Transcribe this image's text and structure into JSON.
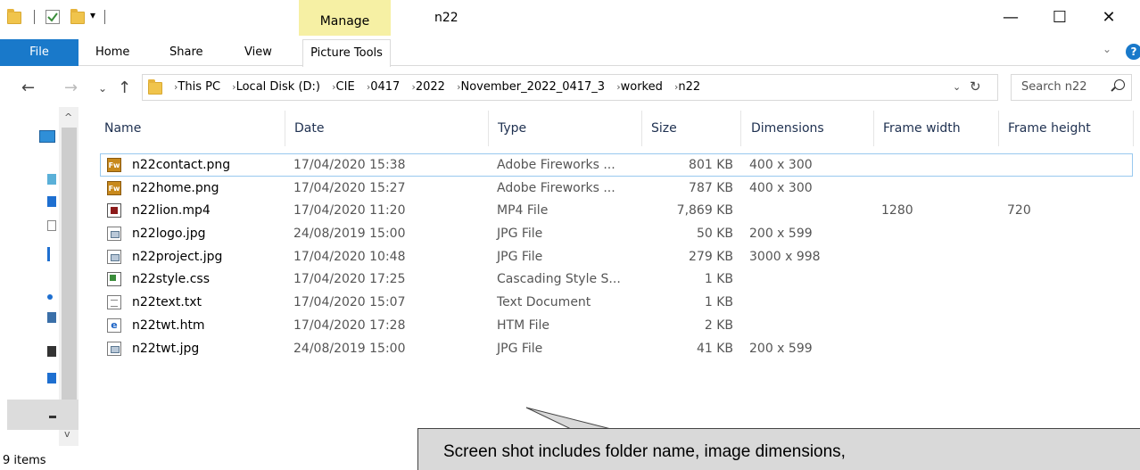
{
  "window": {
    "title": "n22",
    "contextual_tab": "Manage",
    "controls": {
      "minimize": "—",
      "maximize": "☐",
      "close": "✕"
    }
  },
  "ribbon": {
    "tabs": [
      "File",
      "Home",
      "Share",
      "View",
      "Picture Tools"
    ],
    "collapse_glyph": "⌄",
    "help_glyph": "?"
  },
  "address": {
    "back": "←",
    "forward": "→",
    "recent": "⌄",
    "up": "↑",
    "breadcrumbs": [
      "This PC",
      "Local Disk (D:)",
      "CIE",
      "0417",
      "2022",
      "November_2022_0417_3",
      "worked",
      "n22"
    ],
    "separator": "›",
    "dropdown": "⌄",
    "refresh": "↻"
  },
  "search": {
    "placeholder": "Search n22"
  },
  "columns": {
    "name": "Name",
    "date": "Date",
    "type": "Type",
    "size": "Size",
    "dimensions": "Dimensions",
    "frame_width": "Frame width",
    "frame_height": "Frame height"
  },
  "files": [
    {
      "name": "n22contact.png",
      "date": "17/04/2020 15:38",
      "type": "Adobe Fireworks ...",
      "size": "801 KB",
      "dimensions": "400 x 300",
      "frame_width": "",
      "frame_height": "",
      "icon": "fireworks-icon"
    },
    {
      "name": "n22home.png",
      "date": "17/04/2020 15:27",
      "type": "Adobe Fireworks ...",
      "size": "787 KB",
      "dimensions": "400 x 300",
      "frame_width": "",
      "frame_height": "",
      "icon": "fireworks-icon"
    },
    {
      "name": "n22lion.mp4",
      "date": "17/04/2020 11:20",
      "type": "MP4 File",
      "size": "7,869 KB",
      "dimensions": "",
      "frame_width": "1280",
      "frame_height": "720",
      "icon": "video-icon"
    },
    {
      "name": "n22logo.jpg",
      "date": "24/08/2019 15:00",
      "type": "JPG File",
      "size": "50 KB",
      "dimensions": "200 x 599",
      "frame_width": "",
      "frame_height": "",
      "icon": "image-icon"
    },
    {
      "name": "n22project.jpg",
      "date": "17/04/2020 10:48",
      "type": "JPG File",
      "size": "279 KB",
      "dimensions": "3000 x 998",
      "frame_width": "",
      "frame_height": "",
      "icon": "image-icon"
    },
    {
      "name": "n22style.css",
      "date": "17/04/2020 17:25",
      "type": "Cascading Style S...",
      "size": "1 KB",
      "dimensions": "",
      "frame_width": "",
      "frame_height": "",
      "icon": "css-file-icon"
    },
    {
      "name": "n22text.txt",
      "date": "17/04/2020 15:07",
      "type": "Text Document",
      "size": "1 KB",
      "dimensions": "",
      "frame_width": "",
      "frame_height": "",
      "icon": "text-file-icon"
    },
    {
      "name": "n22twt.htm",
      "date": "17/04/2020 17:28",
      "type": "HTM File",
      "size": "2 KB",
      "dimensions": "",
      "frame_width": "",
      "frame_height": "",
      "icon": "html-file-icon"
    },
    {
      "name": "n22twt.jpg",
      "date": "24/08/2019 15:00",
      "type": "JPG File",
      "size": "41 KB",
      "dimensions": "200 x 599",
      "frame_width": "",
      "frame_height": "",
      "icon": "image-icon"
    }
  ],
  "status": {
    "item_count": "9 items"
  },
  "callout": {
    "text": "Screen shot includes folder name, image dimensions,"
  },
  "colors": {
    "accent": "#1979ca",
    "manage_tab": "#f6f0a4",
    "callout_bg": "#d9d9d9"
  }
}
